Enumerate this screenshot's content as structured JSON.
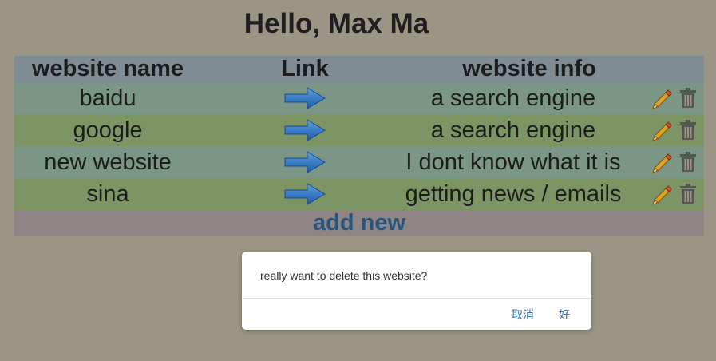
{
  "page": {
    "title": "Hello, Max Ma"
  },
  "table": {
    "headers": {
      "name": "website name",
      "link": "Link",
      "info": "website info"
    },
    "rows": [
      {
        "name": "baidu",
        "info": "a search engine"
      },
      {
        "name": "google",
        "info": "a search engine"
      },
      {
        "name": "new website",
        "info": "I dont know what it is"
      },
      {
        "name": "sina",
        "info": "getting news / emails"
      }
    ],
    "add_label": "add new"
  },
  "dialog": {
    "message": "really want to delete this website?",
    "cancel_label": "取消",
    "ok_label": "好"
  },
  "icons": {
    "link": "arrow-right-icon",
    "edit": "pencil-icon",
    "delete": "trash-icon"
  },
  "colors": {
    "background": "#9a9584",
    "header_row": "#7f8c93",
    "row_a": "#7c9686",
    "row_b": "#7d9565",
    "add_row": "#8f8486",
    "add_link": "#26557e",
    "dialog_button": "#3a6fb0"
  }
}
